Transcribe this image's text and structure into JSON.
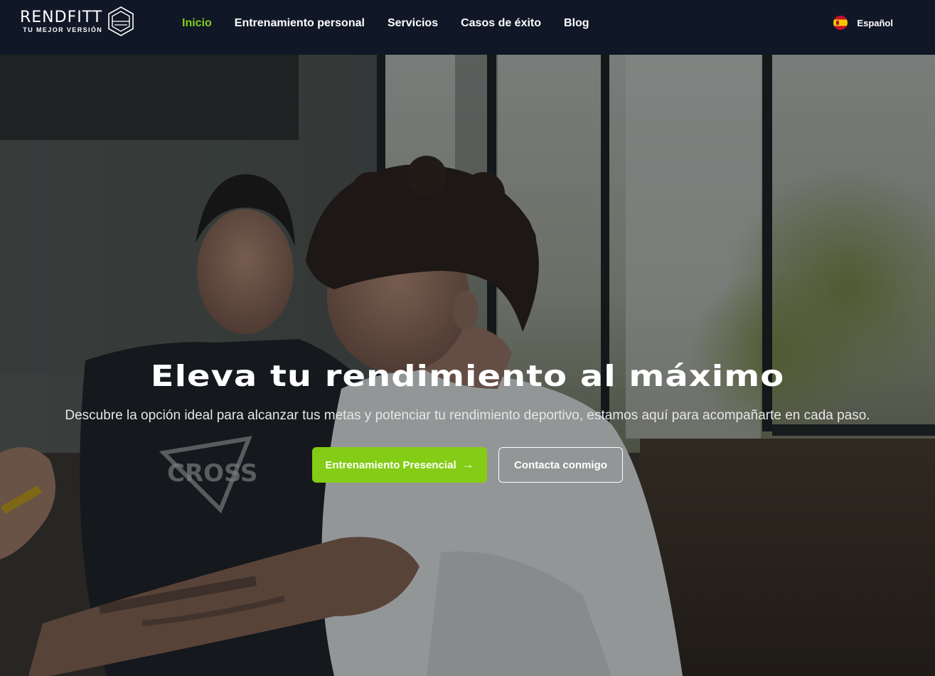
{
  "brand": {
    "name": "RENDFITT",
    "tagline": "TU MEJOR VERSIÓN",
    "accent_color": "#84cc16",
    "header_bg": "#101827"
  },
  "nav": {
    "items": [
      {
        "label": "Inicio",
        "active": true
      },
      {
        "label": "Entrenamiento personal",
        "active": false
      },
      {
        "label": "Servicios",
        "active": false
      },
      {
        "label": "Casos de éxito",
        "active": false
      },
      {
        "label": "Blog",
        "active": false
      }
    ]
  },
  "language": {
    "label": "Español",
    "flag_icon": "spain-flag-icon"
  },
  "hero": {
    "title": "Eleva tu rendimiento al máximo",
    "subtitle": "Descubre la opción ideal para alcanzar tus metas y potenciar tu rendimiento deportivo, estamos aquí para acompañarte en cada paso.",
    "primary_cta": "Entrenamiento Presencial",
    "primary_cta_icon": "arrow-right-icon",
    "secondary_cta": "Contacta conmigo"
  }
}
